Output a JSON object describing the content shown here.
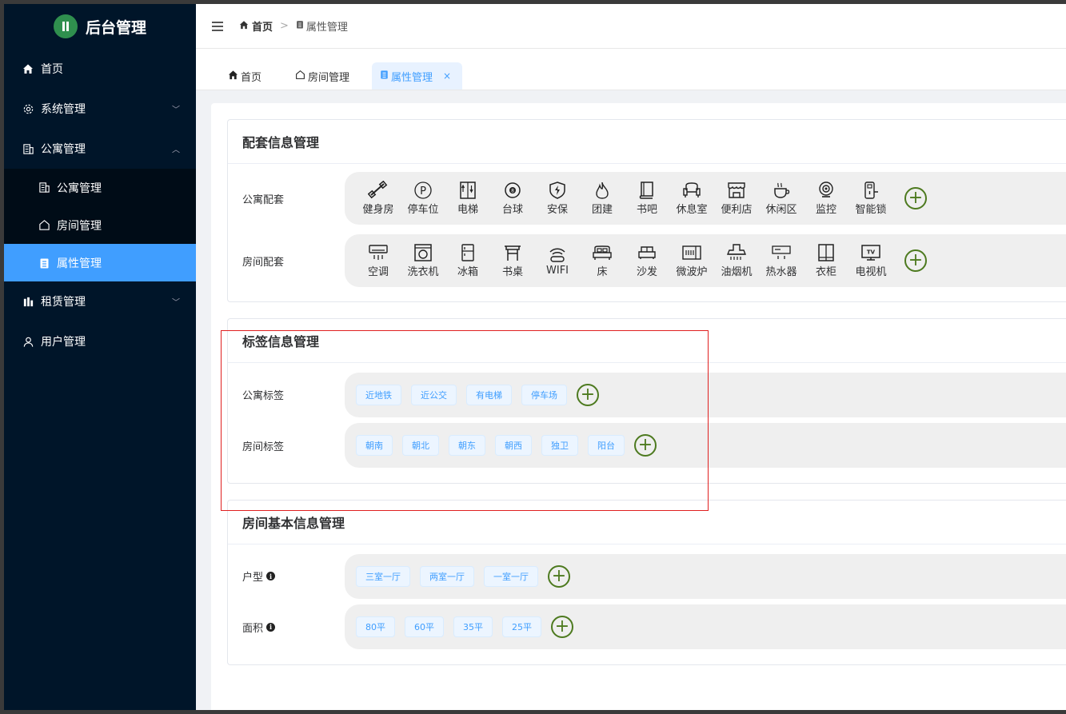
{
  "app": {
    "title": "后台管理"
  },
  "sidebar": {
    "items": [
      {
        "label": "首页",
        "icon": "home-icon"
      },
      {
        "label": "系统管理",
        "icon": "gear-icon",
        "arrow": "chevron-down-icon"
      },
      {
        "label": "公寓管理",
        "icon": "building-icon",
        "arrow": "chevron-up-icon"
      },
      {
        "label": "租赁管理",
        "icon": "chart-icon",
        "arrow": "chevron-down-icon"
      },
      {
        "label": "用户管理",
        "icon": "user-icon"
      }
    ],
    "sub_items": [
      {
        "label": "公寓管理",
        "icon": "building-icon"
      },
      {
        "label": "房间管理",
        "icon": "house-icon"
      },
      {
        "label": "属性管理",
        "icon": "clipboard-icon",
        "active": true
      }
    ]
  },
  "breadcrumb": {
    "home": "首页",
    "separator": ">",
    "current": "属性管理"
  },
  "tabs": [
    {
      "label": "首页",
      "icon": "home-icon"
    },
    {
      "label": "房间管理",
      "icon": "house-icon"
    },
    {
      "label": "属性管理",
      "icon": "clipboard-icon",
      "active": true,
      "close": "×"
    }
  ],
  "facility_card": {
    "title": "配套信息管理",
    "apartment_label": "公寓配套",
    "apartment_items": [
      {
        "label": "健身房",
        "icon": "dumbbell-icon"
      },
      {
        "label": "停车位",
        "icon": "parking-icon"
      },
      {
        "label": "电梯",
        "icon": "elevator-icon"
      },
      {
        "label": "台球",
        "icon": "billiards-icon"
      },
      {
        "label": "安保",
        "icon": "shield-icon"
      },
      {
        "label": "团建",
        "icon": "flame-icon"
      },
      {
        "label": "书吧",
        "icon": "book-icon"
      },
      {
        "label": "休息室",
        "icon": "sofa-icon"
      },
      {
        "label": "便利店",
        "icon": "store-icon"
      },
      {
        "label": "休闲区",
        "icon": "coffee-icon"
      },
      {
        "label": "监控",
        "icon": "camera-icon"
      },
      {
        "label": "智能锁",
        "icon": "lock-icon"
      }
    ],
    "room_label": "房间配套",
    "room_items": [
      {
        "label": "空调",
        "icon": "air-conditioner-icon"
      },
      {
        "label": "洗衣机",
        "icon": "washer-icon"
      },
      {
        "label": "冰箱",
        "icon": "fridge-icon"
      },
      {
        "label": "书桌",
        "icon": "desk-icon"
      },
      {
        "label": "WIFI",
        "icon": "wifi-icon"
      },
      {
        "label": "床",
        "icon": "bed-icon"
      },
      {
        "label": "沙发",
        "icon": "couch-icon"
      },
      {
        "label": "微波炉",
        "icon": "microwave-icon"
      },
      {
        "label": "油烟机",
        "icon": "range-hood-icon"
      },
      {
        "label": "热水器",
        "icon": "water-heater-icon"
      },
      {
        "label": "衣柜",
        "icon": "wardrobe-icon"
      },
      {
        "label": "电视机",
        "icon": "tv-icon"
      }
    ],
    "add_symbol": "+"
  },
  "label_card": {
    "title": "标签信息管理",
    "apartment_label": "公寓标签",
    "apartment_tags": [
      "近地铁",
      "近公交",
      "有电梯",
      "停车场"
    ],
    "room_label": "房间标签",
    "room_tags": [
      "朝南",
      "朝北",
      "朝东",
      "朝西",
      "独卫",
      "阳台"
    ]
  },
  "room_basic_card": {
    "title": "房间基本信息管理",
    "type_label": "户型",
    "type_tags": [
      "三室一厅",
      "两室一厅",
      "一室一厅"
    ],
    "area_label": "面积",
    "area_tags": [
      "80平",
      "60平",
      "35平",
      "25平"
    ],
    "info_glyph": "i"
  },
  "colors": {
    "sidebar_bg": "#001529",
    "active": "#409eff",
    "add_button": "#4d7a1f",
    "highlight_box": "#e02020"
  }
}
